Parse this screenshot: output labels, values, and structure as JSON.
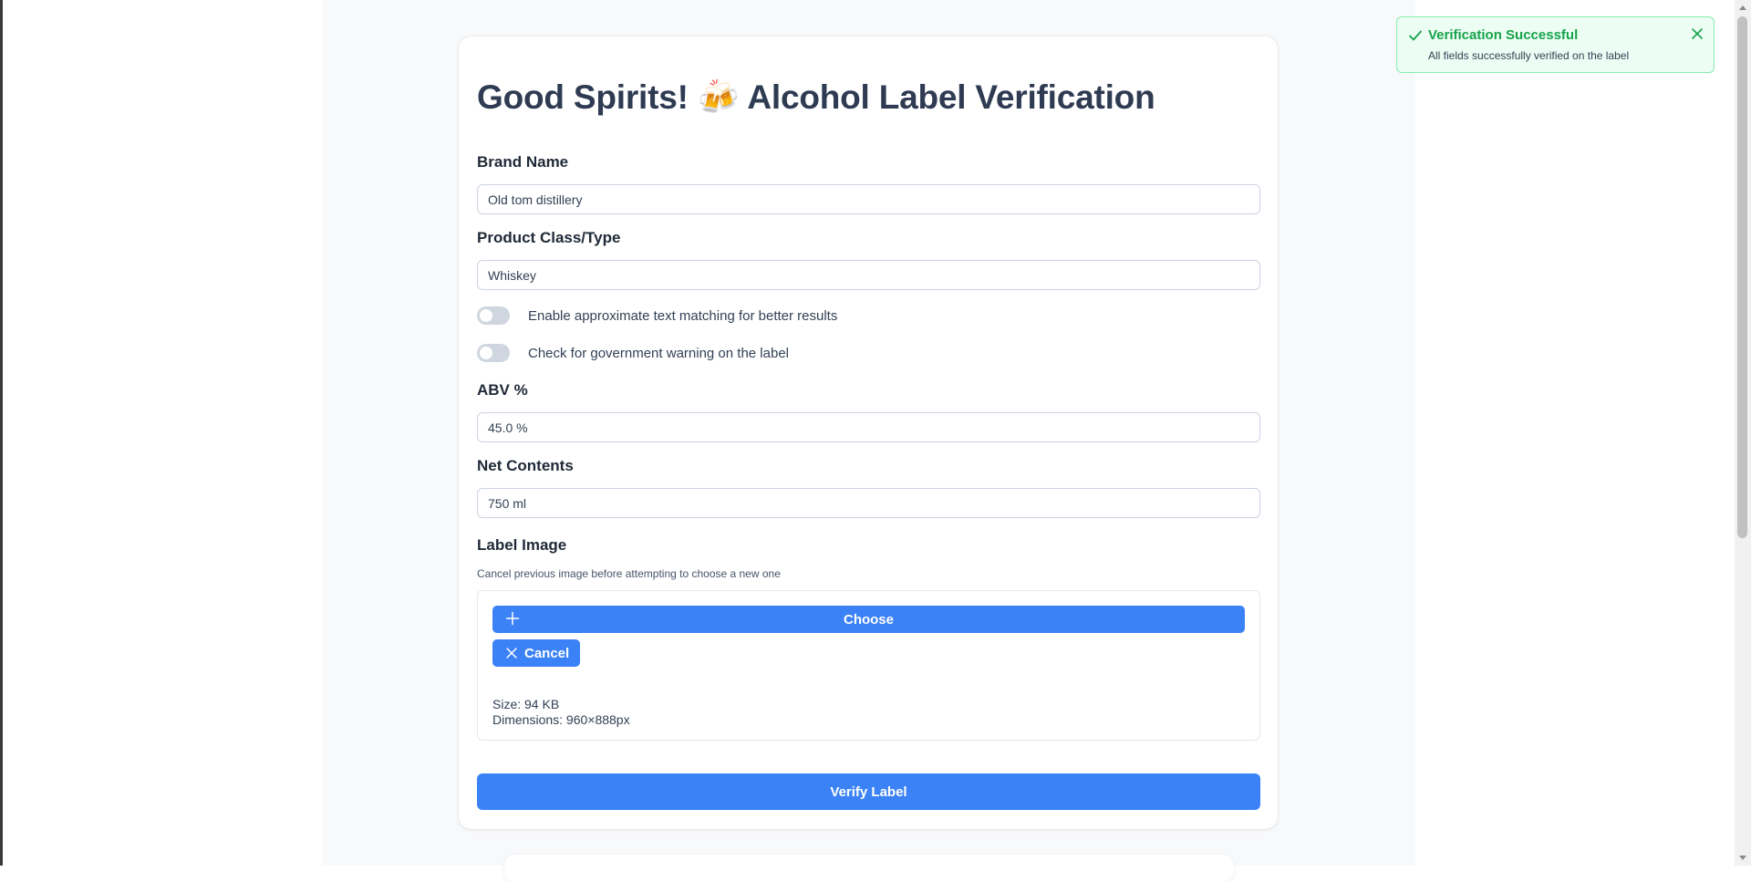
{
  "form": {
    "title": "Good Spirits! 🍻 Alcohol Label Verification",
    "brand_name": {
      "label": "Brand Name",
      "value": "Old tom distillery"
    },
    "product_class": {
      "label": "Product Class/Type",
      "value": "Whiskey"
    },
    "toggles": [
      {
        "label": "Enable approximate text matching for better results",
        "checked": false
      },
      {
        "label": "Check for government warning on the label",
        "checked": false
      }
    ],
    "abv": {
      "label": "ABV %",
      "value": "45.0 %"
    },
    "net_contents": {
      "label": "Net Contents",
      "value": "750 ml"
    },
    "label_image": {
      "label": "Label Image",
      "hint": "Cancel previous image before attempting to choose a new one",
      "choose_label": "Choose",
      "cancel_label": "Cancel",
      "size_text": "Size: 94 KB",
      "dimensions_text": "Dimensions: 960×888px"
    },
    "verify_label": "Verify Label"
  },
  "toast": {
    "title": "Verification Successful",
    "message": "All fields successfully verified on the label"
  },
  "colors": {
    "primary": "#3b82f6",
    "success": "#16a34a",
    "success_bg": "#ecfdf3",
    "heading": "#2f3b52"
  },
  "icons": {
    "choose": "plus-icon",
    "cancel": "close-icon",
    "toast": "check-icon",
    "toast_close": "close-icon"
  }
}
